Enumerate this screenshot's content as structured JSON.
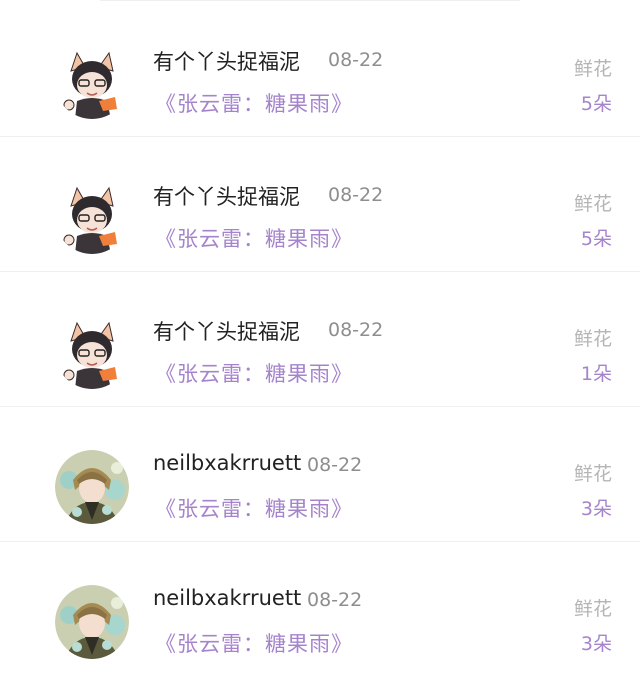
{
  "records": [
    {
      "user": "有个丫头捉福泥",
      "date": "08-22",
      "song": "《张云雷：糖果雨》",
      "gift_label": "鲜花",
      "gift_count": "5朵",
      "avatar_icon": "cartoon-fox-ear-boy-avatar-icon"
    },
    {
      "user": "有个丫头捉福泥",
      "date": "08-22",
      "song": "《张云雷：糖果雨》",
      "gift_label": "鲜花",
      "gift_count": "5朵",
      "avatar_icon": "cartoon-fox-ear-boy-avatar-icon"
    },
    {
      "user": "有个丫头捉福泥",
      "date": "08-22",
      "song": "《张云雷：糖果雨》",
      "gift_label": "鲜花",
      "gift_count": "1朵",
      "avatar_icon": "cartoon-fox-ear-boy-avatar-icon"
    },
    {
      "user": "neilbxakrruett",
      "date": "08-22",
      "song": "《张云雷：糖果雨》",
      "gift_label": "鲜花",
      "gift_count": "3朵",
      "avatar_icon": "anime-boy-flowers-avatar-icon"
    },
    {
      "user": "neilbxakrruett",
      "date": "08-22",
      "song": "《张云雷：糖果雨》",
      "gift_label": "鲜花",
      "gift_count": "3朵",
      "avatar_icon": "anime-boy-flowers-avatar-icon"
    }
  ],
  "colors": {
    "accent": "#a584cc",
    "name": "#222222",
    "date": "#8e8e8e",
    "gift_label": "#b5b5b5",
    "divider": "#efefef"
  }
}
